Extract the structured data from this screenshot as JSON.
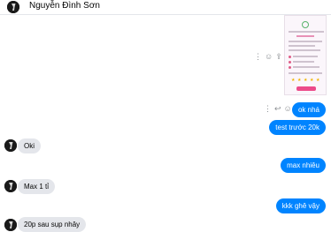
{
  "header": {
    "contact_name": "Nguyễn Đình Sơn"
  },
  "image_message_actions": [
    "more-icon",
    "emoji-icon",
    "share-icon"
  ],
  "message_actions": [
    "more-icon",
    "reply-icon",
    "emoji-icon"
  ],
  "messages": [
    {
      "direction": "outgoing",
      "text": "ok nhá"
    },
    {
      "direction": "outgoing",
      "text": "test trước 20k"
    },
    {
      "direction": "incoming",
      "text": "Oki"
    },
    {
      "direction": "outgoing",
      "text": "max nhiêu"
    },
    {
      "direction": "incoming",
      "text": "Max 1 tỉ"
    },
    {
      "direction": "outgoing",
      "text": "kkk ghê vậy"
    },
    {
      "direction": "incoming",
      "text": "20p sau sụp nhây"
    }
  ],
  "colors": {
    "outgoing_bubble": "#0084ff",
    "incoming_bubble": "#e4e6eb",
    "icon": "#8a8d91"
  }
}
